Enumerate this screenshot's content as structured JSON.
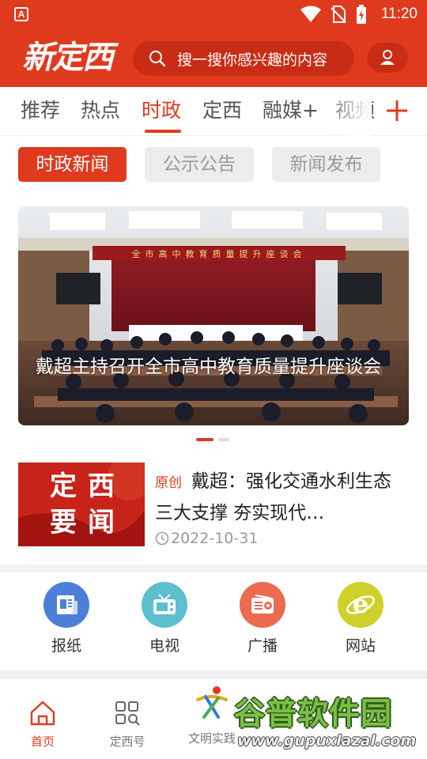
{
  "status_bar": {
    "time": "11:20",
    "app_indicator": "A",
    "icons": [
      "wifi-icon",
      "no-sim-icon",
      "battery-charging-icon"
    ]
  },
  "header": {
    "logo_text": "新定西",
    "search_placeholder": "搜一搜你感兴趣的内容",
    "brand_color": "#e03a1e"
  },
  "channel_tabs": [
    {
      "label": "推荐",
      "active": false
    },
    {
      "label": "热点",
      "active": false
    },
    {
      "label": "时政",
      "active": true
    },
    {
      "label": "定西",
      "active": false
    },
    {
      "label": "融媒+",
      "active": false
    },
    {
      "label": "视频",
      "active": false
    }
  ],
  "sub_tabs": [
    {
      "label": "时政新闻",
      "active": true
    },
    {
      "label": "公示公告",
      "active": false
    },
    {
      "label": "新闻发布",
      "active": false
    }
  ],
  "carousel": {
    "banner_text": "全市高中教育质量提升座谈会",
    "caption": "戴超主持召开全市高中教育质量提升座谈会",
    "slide_index": 1,
    "slide_count": 2
  },
  "news_list": [
    {
      "thumb_line1": "定西",
      "thumb_line2": "要闻",
      "tag": "原创",
      "title": "戴超：强化交通水利生态三大支撑 夯实现代…",
      "date": "2022-10-31"
    }
  ],
  "media_links": [
    {
      "label": "报纸",
      "icon": "newspaper-icon",
      "color": "#4d7fd9"
    },
    {
      "label": "电视",
      "icon": "tv-icon",
      "color": "#5bbfd0"
    },
    {
      "label": "广播",
      "icon": "radio-icon",
      "color": "#ec6a4f"
    },
    {
      "label": "网站",
      "icon": "website-icon",
      "color": "#cfd12a"
    }
  ],
  "bottom_nav": [
    {
      "label": "首页",
      "icon": "home-icon",
      "active": true
    },
    {
      "label": "定西号",
      "icon": "grid-search-icon",
      "active": false
    },
    {
      "label": "文明实践",
      "icon": "civilization-logo-icon",
      "active": false
    }
  ],
  "watermark": {
    "text": "谷普软件园",
    "url": "www.gupuxlazal.com"
  }
}
